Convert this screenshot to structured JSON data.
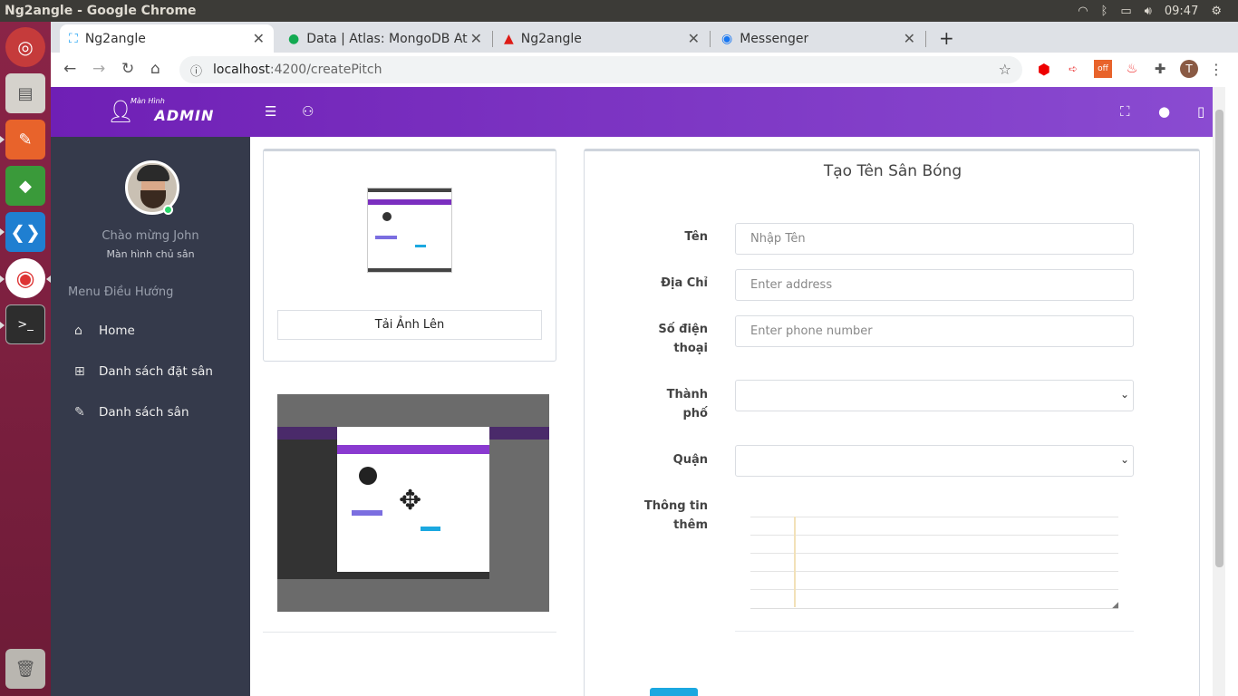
{
  "os_bar": {
    "title": "Ng2angle - Google Chrome",
    "time": "09:47"
  },
  "tabs": [
    {
      "label": "Ng2angle",
      "active": true
    },
    {
      "label": "Data | Atlas: MongoDB At"
    },
    {
      "label": "Ng2angle"
    },
    {
      "label": "Messenger"
    }
  ],
  "address": {
    "host": "localhost",
    "path": ":4200/createPitch"
  },
  "app": {
    "logo_small": "Màn Hình",
    "logo_big": "ADMIN"
  },
  "sidebar": {
    "welcome": "Chào mừng John",
    "role": "Màn hình chủ sân",
    "menu_title": "Menu Điều Hướng",
    "items": [
      {
        "label": "Home",
        "icon": "home-icon"
      },
      {
        "label": "Danh sách đặt sân",
        "icon": "grid-icon"
      },
      {
        "label": "Danh sách sân",
        "icon": "edit-icon"
      }
    ]
  },
  "upload": {
    "button_label": "Tải Ảnh Lên"
  },
  "form": {
    "title": "Tạo Tên Sân Bóng",
    "name_label": "Tên",
    "name_placeholder": "Nhập Tên",
    "address_label": "Địa Chỉ",
    "address_placeholder": "Enter address",
    "phone_label_1": "Số điện",
    "phone_label_2": "thoại",
    "phone_placeholder": "Enter phone number",
    "city_label_1": "Thành",
    "city_label_2": "phố",
    "district_label": "Quận",
    "info_label_1": "Thông tin",
    "info_label_2": "thêm"
  },
  "user_initial": "T",
  "colors": {
    "header_start": "#6f1fb5",
    "header_end": "#8a4bd1",
    "sidebar": "#353a4b",
    "submit": "#1ba8e0"
  }
}
